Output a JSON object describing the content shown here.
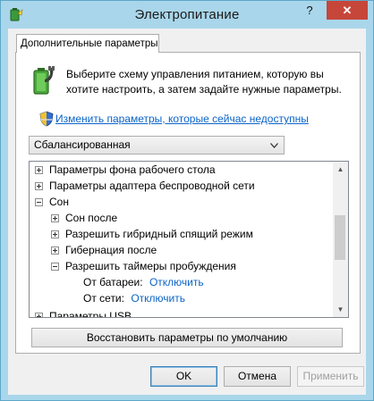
{
  "window": {
    "title": "Электропитание",
    "help_label": "?",
    "close_label": "✕"
  },
  "tab": {
    "label": "Дополнительные параметры"
  },
  "description": "Выберите схему управления питанием, которую вы хотите настроить, а затем задайте нужные параметры.",
  "change_link": "Изменить параметры, которые сейчас недоступны",
  "scheme": {
    "selected": "Сбалансированная"
  },
  "tree": {
    "items": [
      {
        "label": "Параметры фона рабочего стола",
        "level": 0,
        "state": "collapsed"
      },
      {
        "label": "Параметры адаптера беспроводной сети",
        "level": 0,
        "state": "collapsed"
      },
      {
        "label": "Сон",
        "level": 0,
        "state": "expanded"
      },
      {
        "label": "Сон после",
        "level": 1,
        "state": "collapsed"
      },
      {
        "label": "Разрешить гибридный спящий режим",
        "level": 1,
        "state": "collapsed"
      },
      {
        "label": "Гибернация после",
        "level": 1,
        "state": "collapsed"
      },
      {
        "label": "Разрешить таймеры пробуждения",
        "level": 1,
        "state": "expanded"
      },
      {
        "label": "От батареи:",
        "value": "Отключить",
        "level": 2,
        "state": "leaf"
      },
      {
        "label": "От сети:",
        "value": "Отключить",
        "level": 2,
        "state": "leaf"
      },
      {
        "label": "Параметры USB",
        "level": 0,
        "state": "collapsed"
      }
    ]
  },
  "restore_button": "Восстановить параметры по умолчанию",
  "buttons": {
    "ok": "OK",
    "cancel": "Отмена",
    "apply": "Применить"
  }
}
